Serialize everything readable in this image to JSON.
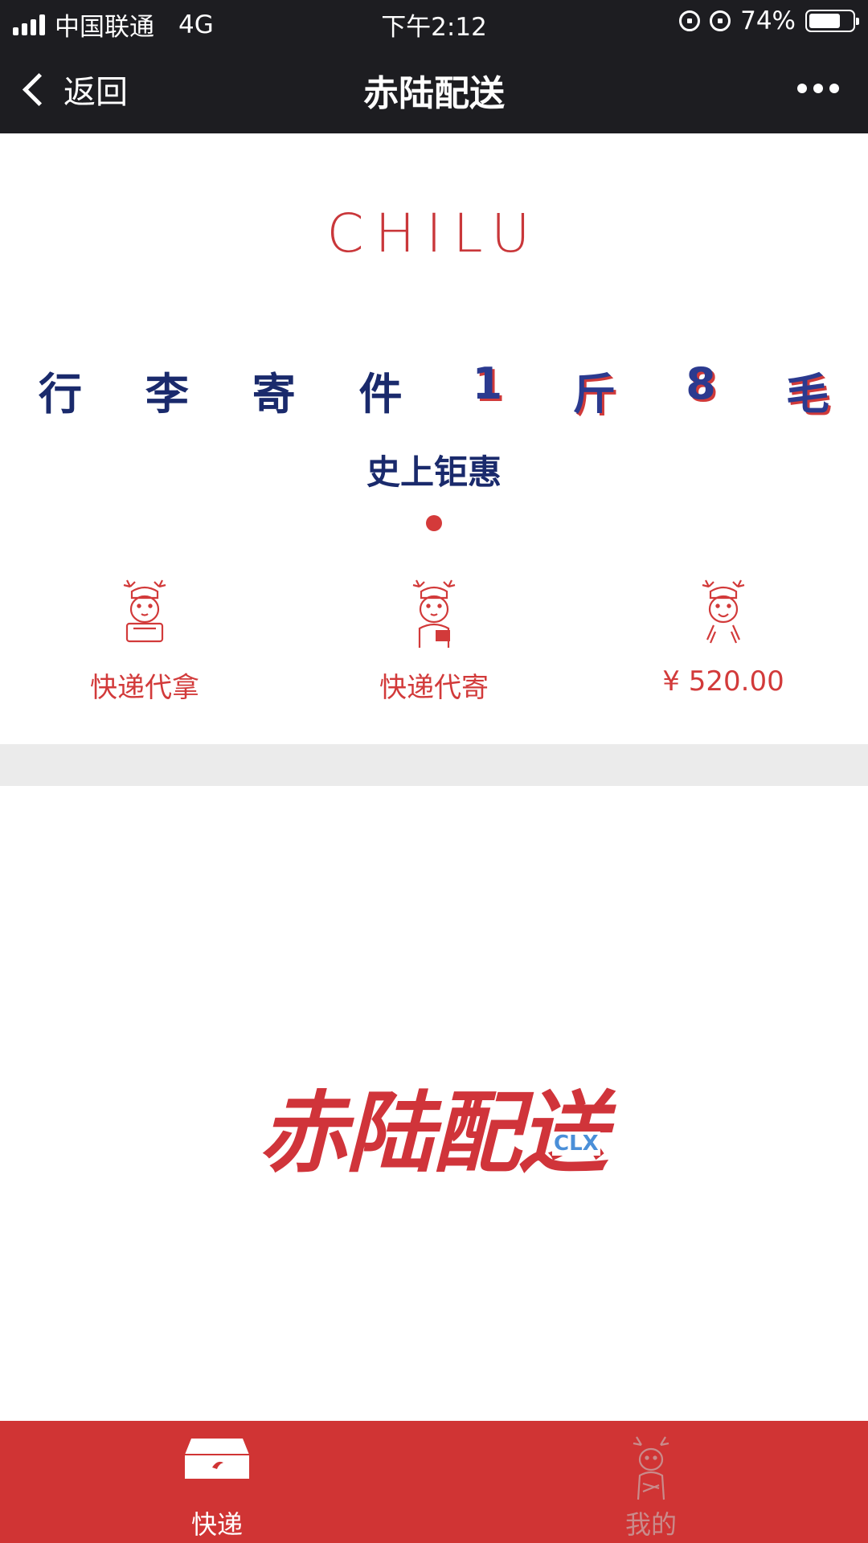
{
  "status_bar": {
    "carrier": "中国联通",
    "network": "4G",
    "time": "下午2:12",
    "battery": "74%",
    "battery_level": 0.74,
    "icons": [
      "signal-icon",
      "orientation-lock-icon",
      "alarm-icon",
      "battery-icon"
    ]
  },
  "nav": {
    "back_label": "返回",
    "title": "赤陆配送",
    "more_icon": "more-icon"
  },
  "banner": {
    "logo_text": "CHILU",
    "slogan_chars": [
      "行",
      "李",
      "寄",
      "件",
      "1",
      "斤",
      "8",
      "毛"
    ],
    "subtitle": "史上钜惠",
    "page_indicator": {
      "count": 1,
      "active": 0
    }
  },
  "services": [
    {
      "label": "快递代拿",
      "icon": "deer-box-icon"
    },
    {
      "label": "快递代寄",
      "icon": "deer-parcel-icon"
    },
    {
      "label": "¥ 520.00",
      "icon": "deer-money-icon"
    }
  ],
  "brand": {
    "cn": "赤陆配送",
    "en": "CLX"
  },
  "tabbar": {
    "tabs": [
      {
        "label": "快递",
        "icon": "box-icon",
        "active": true
      },
      {
        "label": "我的",
        "icon": "deer-avatar-icon",
        "active": false
      }
    ]
  },
  "colors": {
    "accent_red": "#d03434",
    "nav_bg": "#1d1d21",
    "slogan_blue": "#1a2a6c",
    "en_blue": "#4a8fd8"
  }
}
